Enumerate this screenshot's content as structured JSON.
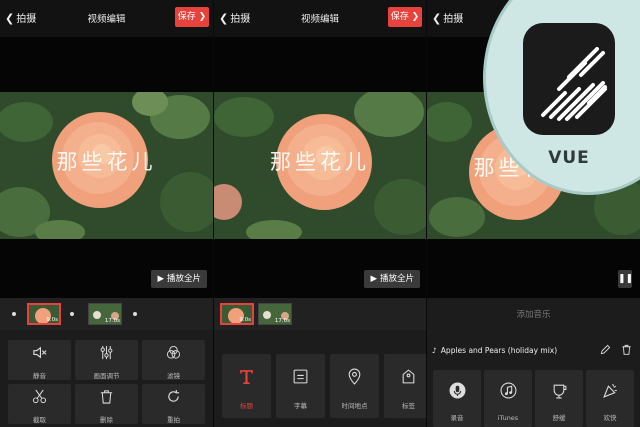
{
  "panel1": {
    "back_label": "拍摄",
    "title": "视频编辑",
    "save_label": "保存",
    "overlay_title": "那些花儿",
    "play_label": "播放全片",
    "clips": [
      {
        "duration": "9.0s"
      },
      {
        "duration": "17.0s"
      }
    ],
    "tools": [
      {
        "label": "静音",
        "icon": "mute-icon"
      },
      {
        "label": "画面调节",
        "icon": "adjust-icon"
      },
      {
        "label": "滤镜",
        "icon": "filter-icon"
      },
      {
        "label": "截取",
        "icon": "scissors-icon"
      },
      {
        "label": "删除",
        "icon": "trash-icon"
      },
      {
        "label": "重拍",
        "icon": "reshoot-icon"
      }
    ]
  },
  "panel2": {
    "back_label": "拍摄",
    "title": "视频编辑",
    "save_label": "保存",
    "overlay_title": "那些花儿",
    "play_label": "播放全片",
    "clips": [
      {
        "duration": "9.0s"
      },
      {
        "duration": "17.0s"
      }
    ],
    "tools": [
      {
        "label": "标题",
        "icon": "title-t-icon",
        "active": true
      },
      {
        "label": "字幕",
        "icon": "subtitle-icon"
      },
      {
        "label": "时间地点",
        "icon": "location-pin-icon"
      },
      {
        "label": "标签",
        "icon": "tag-icon"
      }
    ]
  },
  "panel3": {
    "back_label": "拍摄",
    "overlay_title": "那些花儿",
    "add_music_label": "添加音乐",
    "song_title": "Apples and Pears (holiday mix)",
    "music_tools": [
      {
        "label": "录音",
        "icon": "microphone-icon"
      },
      {
        "label": "iTunes",
        "icon": "music-note-icon"
      },
      {
        "label": "舒缓",
        "icon": "cup-icon"
      },
      {
        "label": "欢快",
        "icon": "party-icon"
      }
    ]
  },
  "badge": {
    "app_name": "VUE"
  },
  "colors": {
    "accent": "#e8423c",
    "background": "#1c1c1c",
    "badge_bg": "#cfe7e4"
  }
}
